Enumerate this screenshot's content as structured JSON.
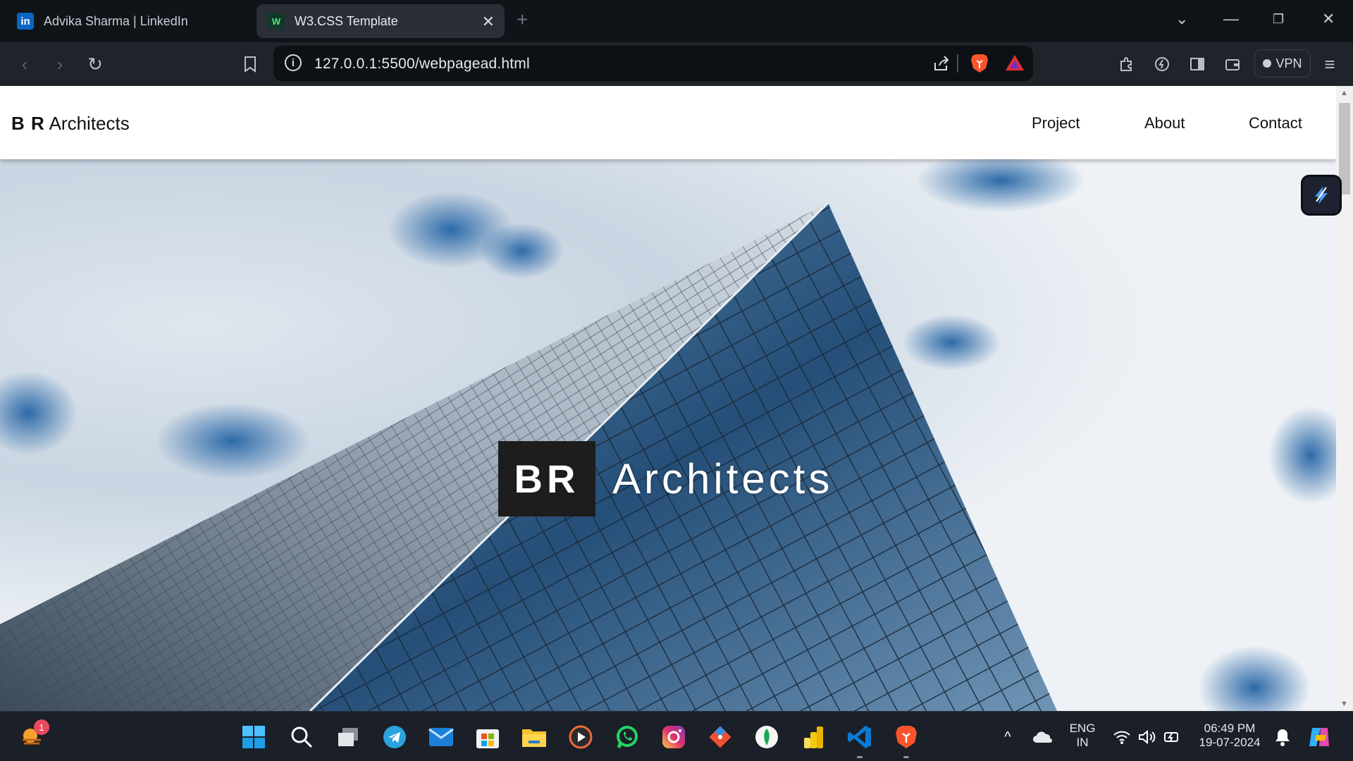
{
  "browser": {
    "tabs": [
      {
        "title": "Advika Sharma | LinkedIn",
        "favicon": "linkedin-icon",
        "active": false
      },
      {
        "title": "W3.CSS Template",
        "favicon": "w3css-icon",
        "active": true
      }
    ],
    "new_tab_glyph": "+",
    "url": "127.0.0.1:5500/webpagead.html",
    "vpn_label": "VPN"
  },
  "site": {
    "brand_bold": "B R",
    "brand_rest": "Architects",
    "nav": [
      "Project",
      "About",
      "Contact"
    ],
    "hero_logo_box": "BR",
    "hero_logo_text": "Architects"
  },
  "taskbar": {
    "weather_badge": "1",
    "apps": [
      "start-icon",
      "search-icon",
      "task-view-icon",
      "telegram-icon",
      "mail-icon",
      "store-icon",
      "file-explorer-icon",
      "media-player-icon",
      "whatsapp-icon",
      "instagram-icon",
      "git-icon",
      "mongodb-icon",
      "power-bi-icon",
      "vscode-icon",
      "brave-icon"
    ],
    "lang_top": "ENG",
    "lang_bottom": "IN",
    "time": "06:49 PM",
    "date": "19-07-2024"
  },
  "colors": {
    "chrome_bg": "#101318",
    "toolbar_bg": "#1f232a",
    "sky_blue": "#2f6fb1",
    "glass_dark": "#1c3e63"
  }
}
